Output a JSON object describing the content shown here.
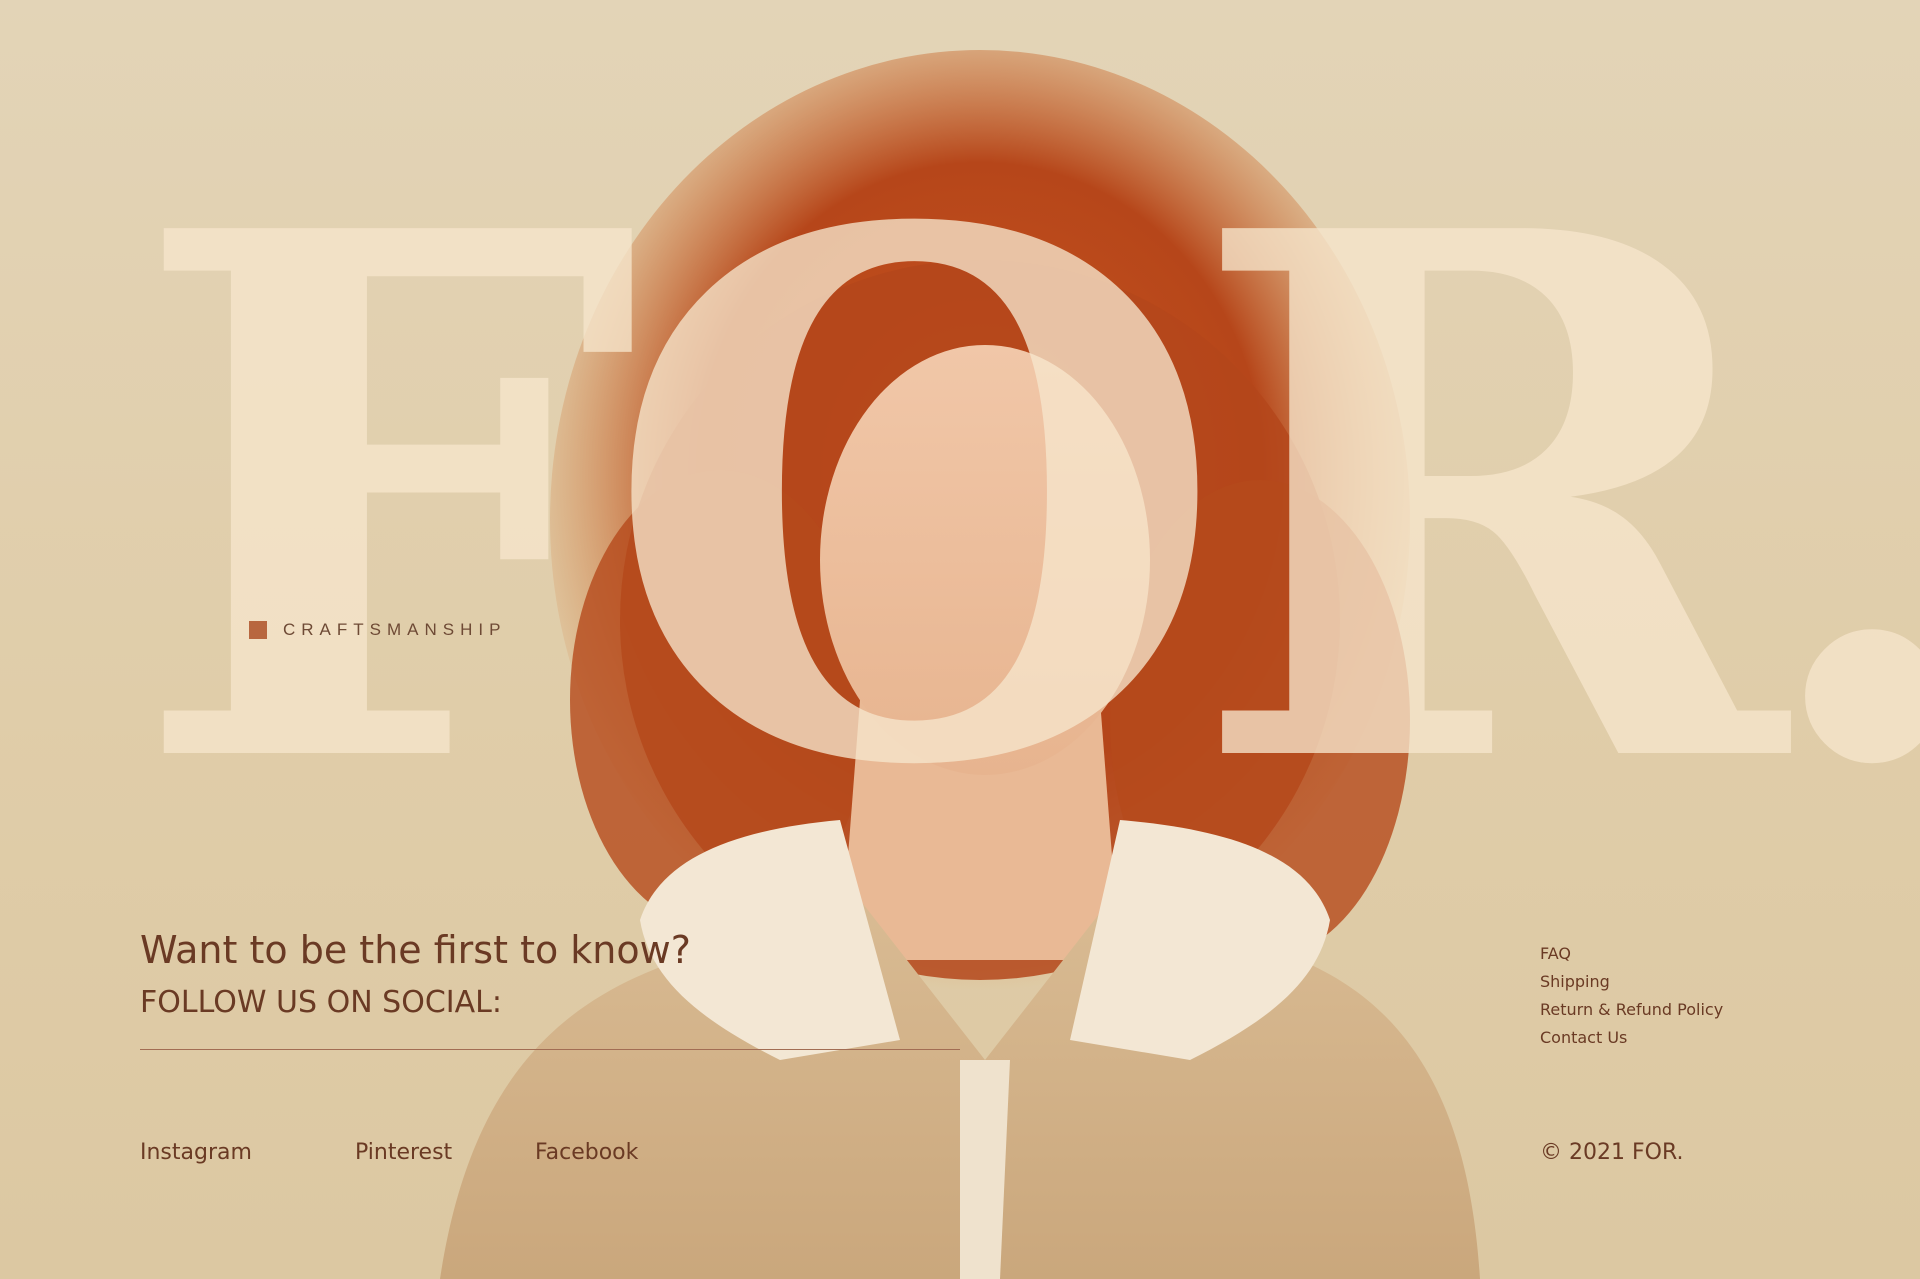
{
  "brand": {
    "wordmark": "FOR.",
    "tagline": "CRAFTSMANSHIP"
  },
  "newsletter": {
    "headline": "Want to be the first to know?",
    "subheadline": "FOLLOW US ON SOCIAL:"
  },
  "social": {
    "links": [
      "Instagram",
      "Pinterest",
      "Facebook"
    ]
  },
  "footer": {
    "links": [
      "FAQ",
      "Shipping",
      "Return & Refund Policy",
      "Contact Us"
    ],
    "copyright": "© 2021 FOR."
  },
  "colors": {
    "background": "#e1cfac",
    "text": "#6a3a24",
    "accent": "#b8673f",
    "wordmark": "#f6e6cc"
  }
}
